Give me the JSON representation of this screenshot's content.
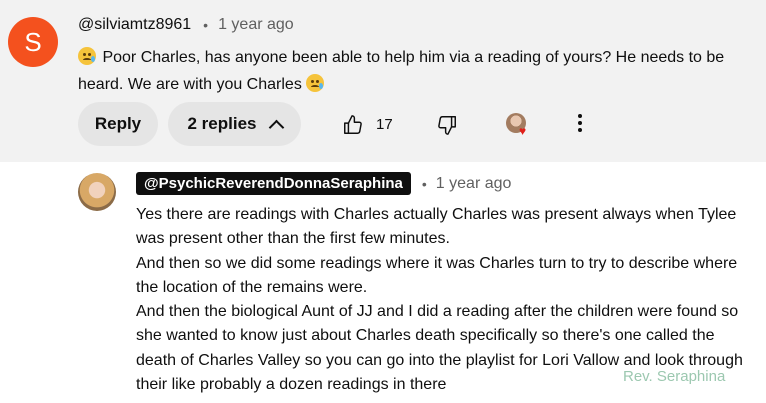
{
  "comment": {
    "avatar_letter": "S",
    "avatar_color": "#f4511e",
    "author": "@silviamtz8961",
    "time": "1 year ago",
    "text": "Poor Charles, has anyone been able to help him via a reading of yours? He needs to be heard. We are with you Charles",
    "emoji": "sad-tear-emoji",
    "reply_label": "Reply",
    "replies_label": "2 replies",
    "like_count": "17"
  },
  "reply": {
    "author": "@PsychicReverendDonnaSeraphina",
    "time": "1 year ago",
    "paragraphs": [
      "Yes there are readings with Charles actually Charles was present always when Tylee was present other than the first few minutes.",
      "And then so we did some readings where it was Charles turn to try to describe where the location of the remains were.",
      "And then the biological Aunt of JJ and I did a reading after the children were found so she wanted to know just about Charles death specifically so there's one called the death of Charles Valley so you can go into the playlist for Lori Vallow and look through their like probably a dozen readings in there"
    ]
  },
  "watermark": "Rev. Seraphina"
}
